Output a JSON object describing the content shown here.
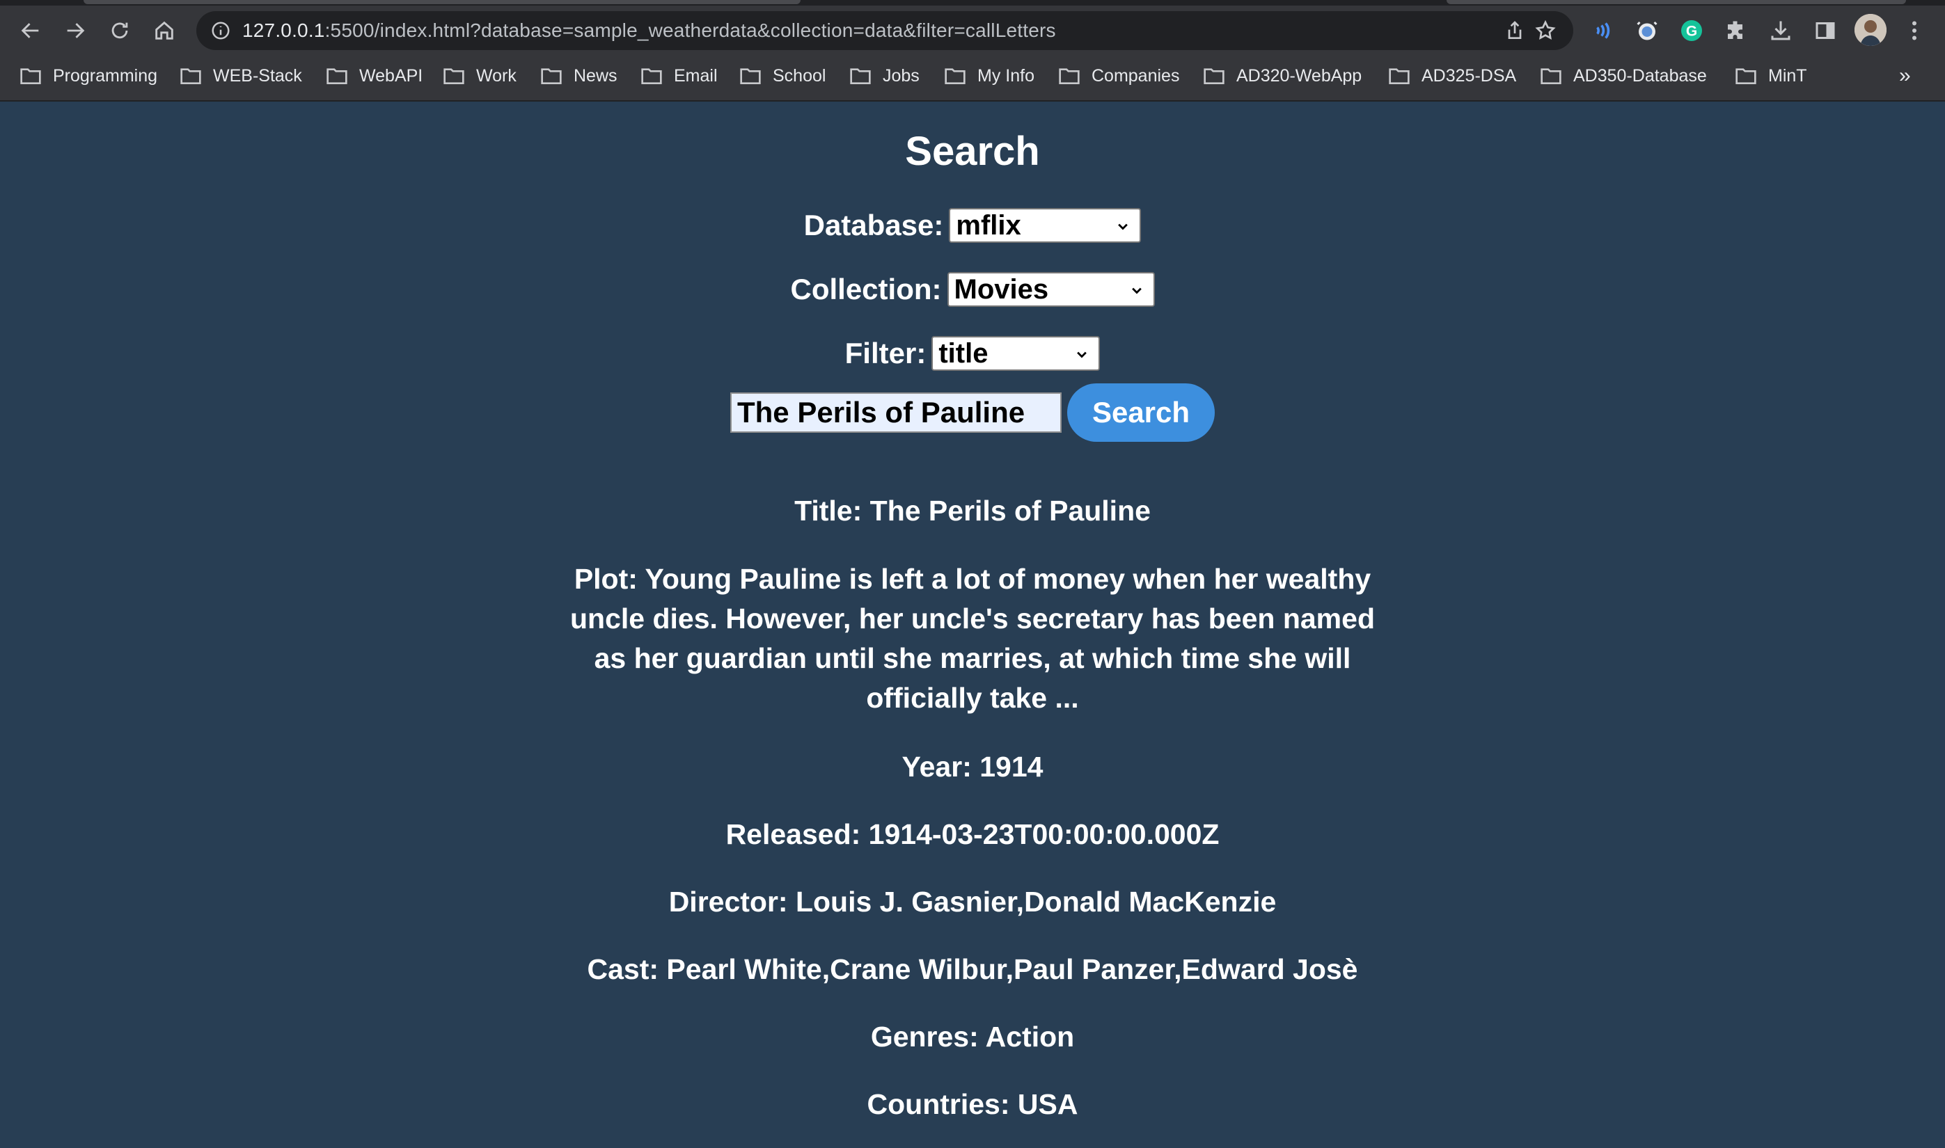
{
  "browser": {
    "url_host": "127.0.0.1",
    "url_rest": ":5500/index.html?database=sample_weatherdata&collection=data&filter=callLetters",
    "bookmarks": [
      {
        "label": "Programming"
      },
      {
        "label": "WEB-Stack"
      },
      {
        "label": "WebAPI"
      },
      {
        "label": "Work"
      },
      {
        "label": "News"
      },
      {
        "label": "Email"
      },
      {
        "label": "School"
      },
      {
        "label": "Jobs"
      },
      {
        "label": "My Info"
      },
      {
        "label": "Companies"
      },
      {
        "label": "AD320-WebApp"
      },
      {
        "label": "AD325-DSA"
      },
      {
        "label": "AD350-Database"
      },
      {
        "label": "MinT"
      }
    ],
    "bookmarks_overflow": "»"
  },
  "page": {
    "title": "Search",
    "database_label": "Database:",
    "database_value": "mflix",
    "collection_label": "Collection:",
    "collection_value": "Movies",
    "filter_label": "Filter:",
    "filter_value": "title",
    "search_value": "The Perils of Pauline",
    "search_button": "Search"
  },
  "result": {
    "title": "Title: The Perils of Pauline",
    "plot": "Plot: Young Pauline is left a lot of money when her wealthy uncle dies. However, her uncle's secretary has been named as her guardian until she marries, at which time she will officially take ...",
    "year": "Year: 1914",
    "released": "Released: 1914-03-23T00:00:00.000Z",
    "director": "Director: Louis J. Gasnier,Donald MacKenzie",
    "cast": "Cast: Pearl White,Crane Wilbur,Paul Panzer,Edward Josè",
    "genres": "Genres: Action",
    "countries": "Countries: USA"
  }
}
